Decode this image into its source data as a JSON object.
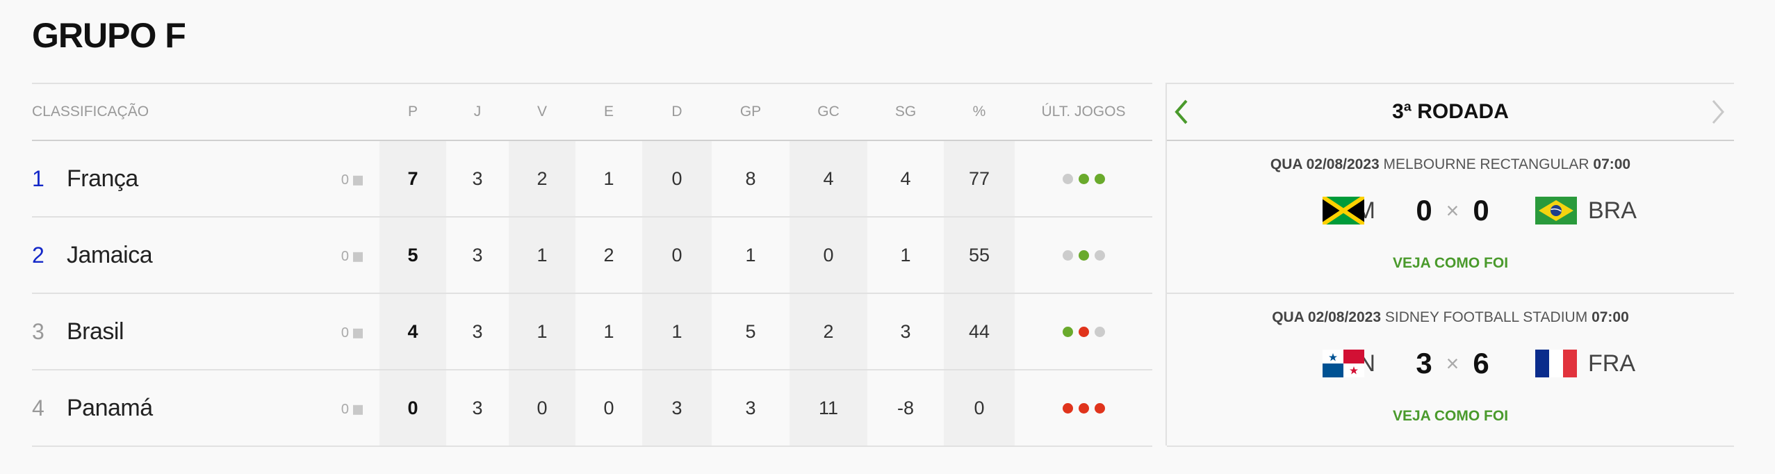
{
  "group_title": "GRUPO F",
  "standings": {
    "headers": {
      "team": "CLASSIFICAÇÃO",
      "p": "P",
      "j": "J",
      "v": "V",
      "e": "E",
      "d": "D",
      "gp": "GP",
      "gc": "GC",
      "sg": "SG",
      "pct": "%",
      "last": "ÚLT. JOGOS"
    },
    "rows": [
      {
        "pos": "1",
        "qualified": true,
        "name": "França",
        "variation": "0",
        "p": "7",
        "j": "3",
        "v": "2",
        "e": "1",
        "d": "0",
        "gp": "8",
        "gc": "4",
        "sg": "4",
        "pct": "77",
        "last": [
          "empate",
          "vitoria",
          "vitoria"
        ]
      },
      {
        "pos": "2",
        "qualified": true,
        "name": "Jamaica",
        "variation": "0",
        "p": "5",
        "j": "3",
        "v": "1",
        "e": "2",
        "d": "0",
        "gp": "1",
        "gc": "0",
        "sg": "1",
        "pct": "55",
        "last": [
          "empate",
          "vitoria",
          "empate"
        ]
      },
      {
        "pos": "3",
        "qualified": false,
        "name": "Brasil",
        "variation": "0",
        "p": "4",
        "j": "3",
        "v": "1",
        "e": "1",
        "d": "1",
        "gp": "5",
        "gc": "2",
        "sg": "3",
        "pct": "44",
        "last": [
          "vitoria",
          "derrota",
          "empate"
        ]
      },
      {
        "pos": "4",
        "qualified": false,
        "name": "Panamá",
        "variation": "0",
        "p": "0",
        "j": "3",
        "v": "0",
        "e": "0",
        "d": "3",
        "gp": "3",
        "gc": "11",
        "sg": "-8",
        "pct": "0",
        "last": [
          "derrota",
          "derrota",
          "derrota"
        ]
      }
    ]
  },
  "rounds": {
    "title": "3ª RODADA",
    "matches": [
      {
        "date": "QUA 02/08/2023",
        "venue": "MELBOURNE RECTANGULAR",
        "time": "07:00",
        "home": "JAM",
        "home_flag": "jamaica-flag",
        "home_score": "0",
        "separator": "×",
        "away_score": "0",
        "away": "BRA",
        "away_flag": "brazil-flag",
        "link": "VEJA COMO FOI"
      },
      {
        "date": "QUA 02/08/2023",
        "venue": "SIDNEY FOOTBALL STADIUM",
        "time": "07:00",
        "home": "PAN",
        "home_flag": "panama-flag",
        "home_score": "3",
        "separator": "×",
        "away_score": "6",
        "away": "FRA",
        "away_flag": "france-flag",
        "link": "VEJA COMO FOI"
      }
    ]
  },
  "colors": {
    "qualified_position": "#1428c8",
    "win_dot": "#6aaa2c",
    "draw_dot": "#cccccc",
    "loss_dot": "#e0341c",
    "link_green": "#4a9a2c",
    "arrow_active": "#4a9a2c",
    "arrow_inactive": "#c8c8c8"
  }
}
